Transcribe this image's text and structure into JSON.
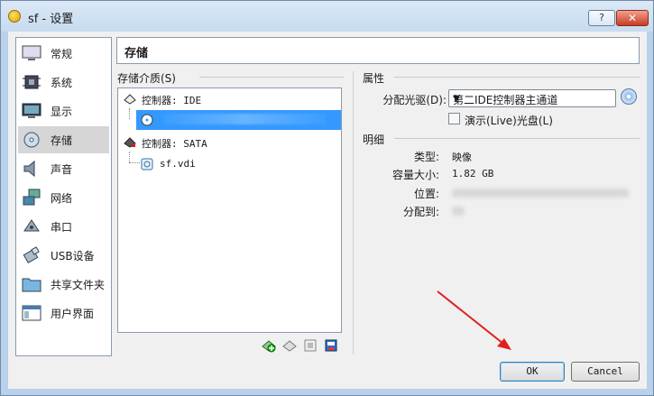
{
  "window": {
    "title": "sf - 设置",
    "help_label": "?",
    "close_label": "✕"
  },
  "sidebar": {
    "items": [
      {
        "label": "常规",
        "icon": "monitor-icon"
      },
      {
        "label": "系统",
        "icon": "chip-icon"
      },
      {
        "label": "显示",
        "icon": "display-icon"
      },
      {
        "label": "存储",
        "icon": "disk-icon"
      },
      {
        "label": "声音",
        "icon": "speaker-icon"
      },
      {
        "label": "网络",
        "icon": "network-icon"
      },
      {
        "label": "串口",
        "icon": "serial-port-icon"
      },
      {
        "label": "USB设备",
        "icon": "usb-icon"
      },
      {
        "label": "共享文件夹",
        "icon": "folder-icon"
      },
      {
        "label": "用户界面",
        "icon": "window-icon"
      }
    ],
    "selected": "存储"
  },
  "page": {
    "title": "存储"
  },
  "storage_tree": {
    "label": "存储介质(S)",
    "controllers": [
      {
        "label": "控制器: IDE",
        "children": [
          {
            "label": ""
          }
        ]
      },
      {
        "label": "控制器: SATA",
        "children": [
          {
            "label": "sf.vdi"
          }
        ]
      }
    ]
  },
  "attributes": {
    "section_label": "属性",
    "drive_label": "分配光驱(D):",
    "drive_value": "第二IDE控制器主通道",
    "live_cd_label": "演示(Live)光盘(L)",
    "live_cd_checked": false
  },
  "details": {
    "section_label": "明细",
    "type_label": "类型:",
    "type_value": "映像",
    "size_label": "容量大小:",
    "size_value": "1.82  GB",
    "location_label": "位置:",
    "attached_label": "分配到:"
  },
  "buttons": {
    "ok": "OK",
    "cancel": "Cancel"
  },
  "colors": {
    "selection": "#3399ff",
    "arrow": "#e02020"
  }
}
